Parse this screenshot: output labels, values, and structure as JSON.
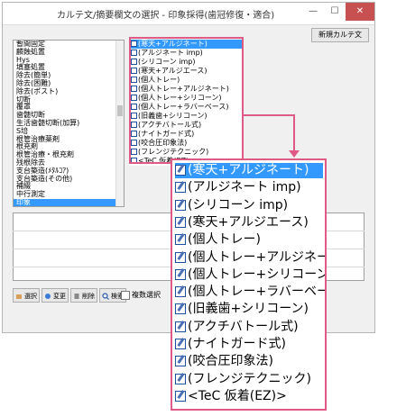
{
  "window": {
    "title": "カルテ文/摘要欄文の選択 - 印象採得(歯冠修復・適合)",
    "min_glyph": "—",
    "max_glyph": "☐",
    "close_glyph": "✕",
    "new_button": "新規カルテ文"
  },
  "categories": [
    "暫間固定",
    "麟蝕処置",
    "Hys",
    "填塞処置",
    "除去(簡単)",
    "除去(困難)",
    "除去(ポスト)",
    "切断",
    "覆罩",
    "歯髄切断",
    "生活歯髄切断(加算)",
    "S培",
    "根管治療薬剤",
    "根充剤",
    "根管治療・根充剤",
    "残根除去",
    "支台築造(ﾒﾀﾙｺｱ)",
    "支台築造(その他)",
    "補綴",
    "中行測定",
    "印象"
  ],
  "selected_category_index": 20,
  "items": [
    "(寒天+アルジネート)",
    "(アルジネート imp)",
    "(シリコーン imp)",
    "(寒天+アルジエース)",
    "(個人トレー)",
    "(個人トレー+アルジネート)",
    "(個人トレー+シリコーン)",
    "(個人トレー+ラバーベース)",
    "(旧義歯+シリコーン)",
    "(アクチバトール式)",
    "(ナイトガード式)",
    "(咬合圧印象法)",
    "(フレンジテクニック)",
    "<TeC 仮着(EZ)>"
  ],
  "selected_item_index": 0,
  "toolbar": {
    "select": "選択",
    "change": "変更",
    "delete": "削除",
    "search": "検索",
    "multi_select": "複数選択"
  },
  "colors": {
    "highlight": "#3399ff",
    "callout": "#e05a86",
    "close": "#c75050"
  },
  "icons": {
    "item": "edit-note-icon"
  }
}
